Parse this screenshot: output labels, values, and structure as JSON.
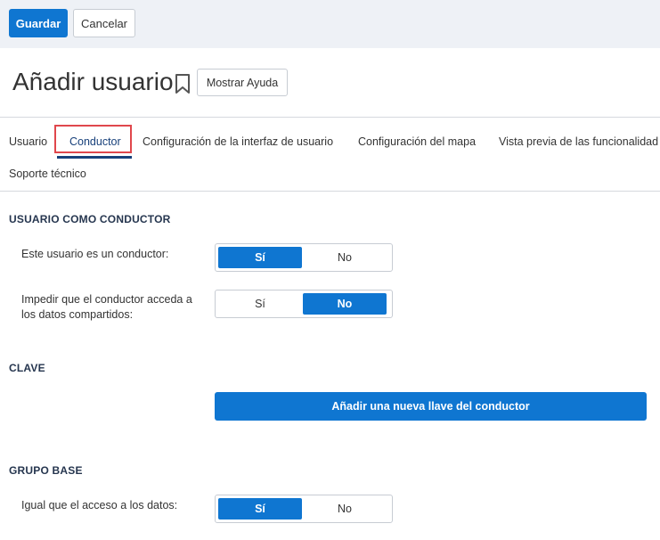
{
  "toolbar": {
    "save_label": "Guardar",
    "cancel_label": "Cancelar"
  },
  "header": {
    "title": "Añadir usuario",
    "help_label": "Mostrar Ayuda"
  },
  "tabs": [
    {
      "label": "Usuario",
      "active": false
    },
    {
      "label": "Conductor",
      "active": true
    },
    {
      "label": "Configuración de la interfaz de usuario",
      "active": false
    },
    {
      "label": "Configuración del mapa",
      "active": false
    },
    {
      "label": "Vista previa de las funcionalidad",
      "active": false
    },
    {
      "label": "Soporte técnico",
      "active": false
    }
  ],
  "sections": {
    "driver": {
      "title": "USUARIO COMO CONDUCTOR",
      "is_driver": {
        "label": "Este usuario es un conductor:",
        "yes": "Sí",
        "no": "No",
        "selected": "Sí"
      },
      "block_shared": {
        "label_line1": "Impedir que el conductor acceda a",
        "label_line2": "los datos compartidos:",
        "yes": "Sí",
        "no": "No",
        "selected": "No"
      }
    },
    "key": {
      "title": "CLAVE",
      "add_key_label": "Añadir una nueva llave del conductor"
    },
    "group": {
      "title": "GRUPO BASE",
      "same_access": {
        "label": "Igual que el acceso a los datos:",
        "yes": "Sí",
        "no": "No",
        "selected": "Sí"
      }
    }
  },
  "colors": {
    "primary": "#0f76d1",
    "active_tab": "#17407a",
    "highlight": "#e0474c",
    "section_title": "#26364f"
  },
  "icons": {
    "bookmark": "bookmark-icon"
  }
}
